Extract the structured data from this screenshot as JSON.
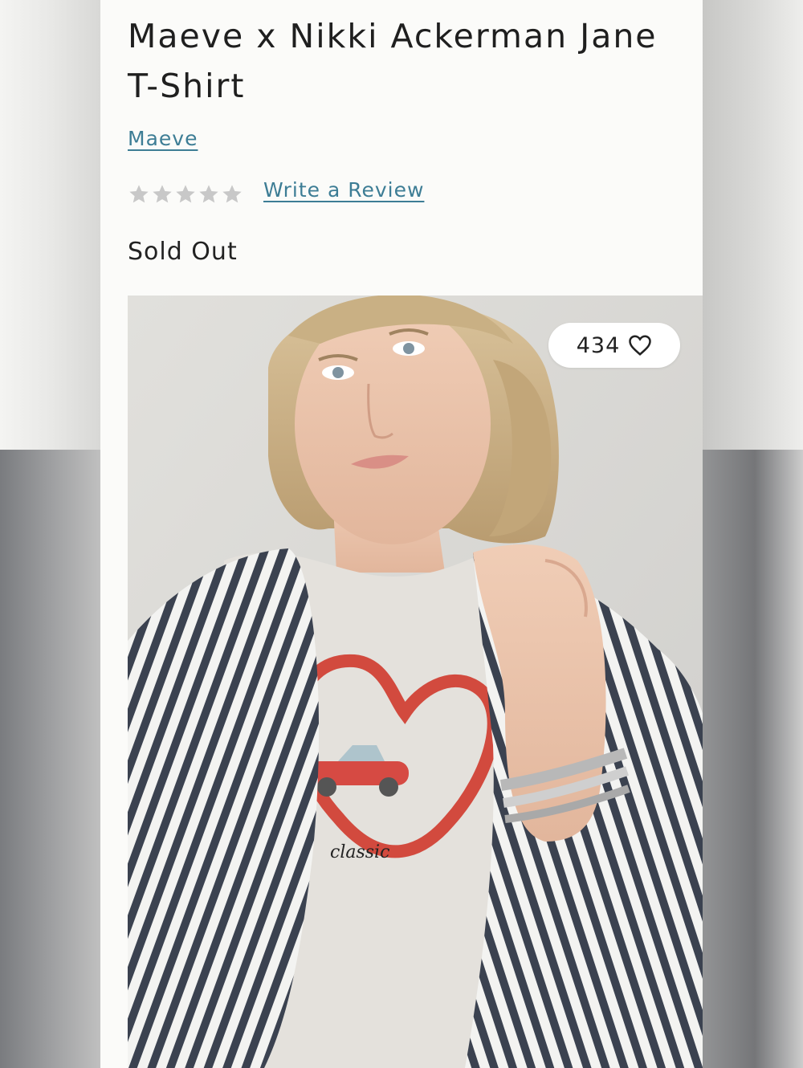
{
  "product": {
    "title": "Maeve x Nikki Ackerman Jane T-Shirt",
    "brand": "Maeve",
    "rating": {
      "value": 0,
      "max": 5
    },
    "review_link": "Write a Review",
    "availability": "Sold Out",
    "likes": "434",
    "image_caption": "classic"
  },
  "icons": {
    "rating_star": "star-icon",
    "like": "heart-icon"
  },
  "colors": {
    "link": "#3d7d95",
    "star_empty": "#c8c8c8",
    "text": "#1f1f1f",
    "background": "#fbfbf9"
  }
}
